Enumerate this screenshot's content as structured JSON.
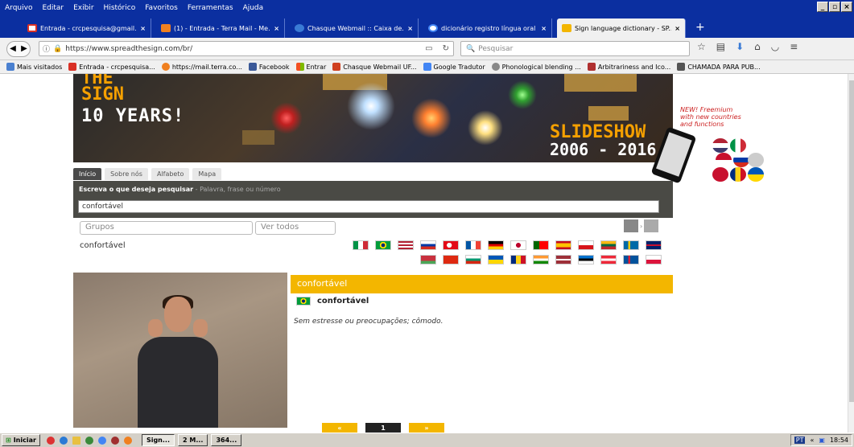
{
  "menubar": {
    "items": [
      "Arquivo",
      "Editar",
      "Exibir",
      "Histórico",
      "Favoritos",
      "Ferramentas",
      "Ajuda"
    ],
    "window_buttons": [
      "_",
      "$",
      "X"
    ]
  },
  "tabs": [
    {
      "title": "Entrada - crcpesquisa@gmail...",
      "close": "×",
      "color": "#d93025"
    },
    {
      "title": "(1) - Entrada - Terra Mail - Me...",
      "close": "×",
      "color": "#f08020"
    },
    {
      "title": "Chasque Webmail :: Caixa de...",
      "close": "×",
      "color": "#3a7bd5"
    },
    {
      "title": "dicionário registro língua oral ...",
      "close": "×",
      "color": "#4285f4"
    },
    {
      "title": "Sign language dictionary - SP...",
      "close": "×",
      "color": "#f3b600"
    }
  ],
  "newtab": "+",
  "nav": {
    "url": "https://www.spreadthesign.com/br/",
    "search_placeholder": "Pesquisar"
  },
  "bookmarks": [
    {
      "label": "Mais visitados",
      "color": "#4a80d0"
    },
    {
      "label": "Entrada - crcpesquisa...",
      "color": "#d93025"
    },
    {
      "label": "https://mail.terra.co...",
      "color": "#f08020"
    },
    {
      "label": "Facebook",
      "color": "#3b5998"
    },
    {
      "label": "Entrar",
      "color": "#f3b600"
    },
    {
      "label": "Chasque Webmail UF...",
      "color": "#d04020"
    },
    {
      "label": "Google Tradutor",
      "color": "#4285f4"
    },
    {
      "label": "Phonological blending ...",
      "color": "#888888"
    },
    {
      "label": "Arbitrariness and Ico...",
      "color": "#b03030"
    },
    {
      "label": "CHAMADA PARA PUB...",
      "color": "#555555"
    }
  ],
  "banner": {
    "logo": "THE\nSIGN",
    "years": "10 YEARS!",
    "slideshow": "SLIDESHOW",
    "range": "2006 - 2016",
    "promo": "NEW! Freemium\nwith new countries\nand functions"
  },
  "site_tabs": [
    "Início",
    "Sobre nós",
    "Alfabeto",
    "Mapa"
  ],
  "search": {
    "hint_bold": "Escreva o que deseja pesquisar",
    "hint_rest": " - Palavra, frase ou número",
    "value": "confortável",
    "groups": "Grupos",
    "see_all": "Ver todos"
  },
  "result": {
    "word": "confortável",
    "header": "confortável",
    "title": "confortável",
    "definition": "Sem estresse ou preocupações; cômodo."
  },
  "flags_row1": [
    "it",
    "br",
    "us",
    "ru",
    "tr",
    "fr",
    "de",
    "jp",
    "pt",
    "es",
    "cz",
    "lt",
    "se",
    "gb"
  ],
  "flags_row2": [
    "by",
    "cn",
    "bg",
    "ua",
    "ro",
    "in",
    "lv",
    "ee",
    "at",
    "is",
    "pl"
  ],
  "pager": {
    "prev": "«",
    "current": "1",
    "next": "»"
  },
  "taskbar": {
    "start": "Iniciar",
    "tasks": [
      "Sign...",
      "2 M...",
      "364..."
    ],
    "clock": "18:54",
    "lang": "PT"
  }
}
